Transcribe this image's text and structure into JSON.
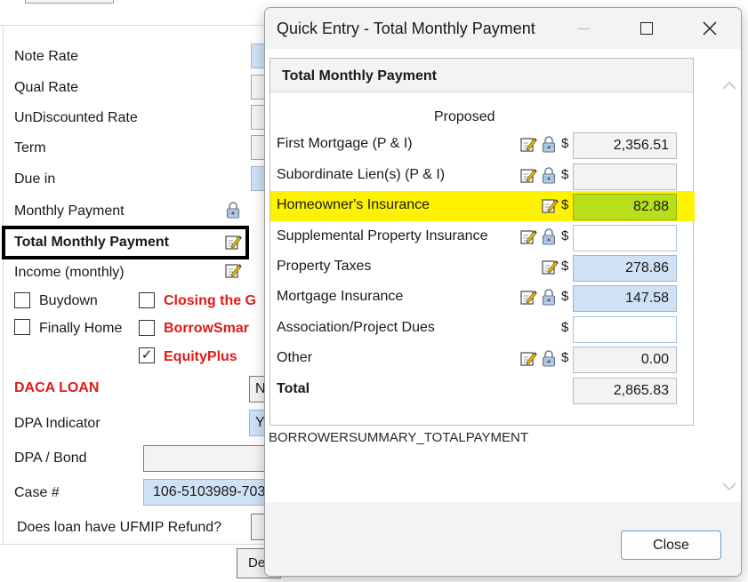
{
  "background": {
    "fields": [
      {
        "label": "Note Rate"
      },
      {
        "label": "Qual Rate"
      },
      {
        "label": "UnDiscounted Rate"
      },
      {
        "label": "Term"
      },
      {
        "label": "Due in"
      },
      {
        "label": "Monthly Payment"
      },
      {
        "label": "Total Monthly Payment"
      },
      {
        "label": "Income (monthly)"
      }
    ],
    "checkboxes": [
      {
        "label": "Buydown",
        "checked": false
      },
      {
        "label": "Finally Home",
        "checked": false
      },
      {
        "label": "Closing the G",
        "checked": false
      },
      {
        "label": "BorrowSmar",
        "checked": false
      },
      {
        "label": "EquityPlus",
        "checked": true
      }
    ],
    "check_mark": "✓",
    "daca_label": "DACA LOAN",
    "daca_value": "N",
    "dpa_indicator_label": "DPA Indicator",
    "dpa_indicator_value": "Y",
    "dpa_bond_label": "DPA / Bond",
    "case_label": "Case #",
    "case_value": "106-5103989-703",
    "ufmip_label": "Does loan have UFMIP Refund?",
    "bottom_button_label": "De"
  },
  "dialog": {
    "title": "Quick Entry - Total Monthly Payment",
    "panel_title": "Total Monthly Payment",
    "column_header": "Proposed",
    "currency": "$",
    "rows": [
      {
        "label": "First Mortgage (P & I)",
        "value": "2,356.51"
      },
      {
        "label": "Subordinate Lien(s) (P & I)",
        "value": ""
      },
      {
        "label": "Homeowner's Insurance",
        "value": "82.88"
      },
      {
        "label": "Supplemental Property Insurance",
        "value": ""
      },
      {
        "label": "Property Taxes",
        "value": "278.86"
      },
      {
        "label": "Mortgage Insurance",
        "value": "147.58"
      },
      {
        "label": "Association/Project Dues",
        "value": ""
      },
      {
        "label": "Other",
        "value": "0.00"
      },
      {
        "label": "Total",
        "value": "2,865.83"
      }
    ],
    "field_id": "BORROWERSUMMARY_TOTALPAYMENT",
    "close_label": "Close",
    "scroll_up_glyph": "︿",
    "scroll_down_glyph": "﹀",
    "icons": {
      "edit": "edit-note-icon",
      "lock": "lock-icon"
    },
    "colors": {
      "highlight": "#fff200",
      "green_field": "#b8df1a",
      "blue_field": "#cfe1f5"
    }
  }
}
